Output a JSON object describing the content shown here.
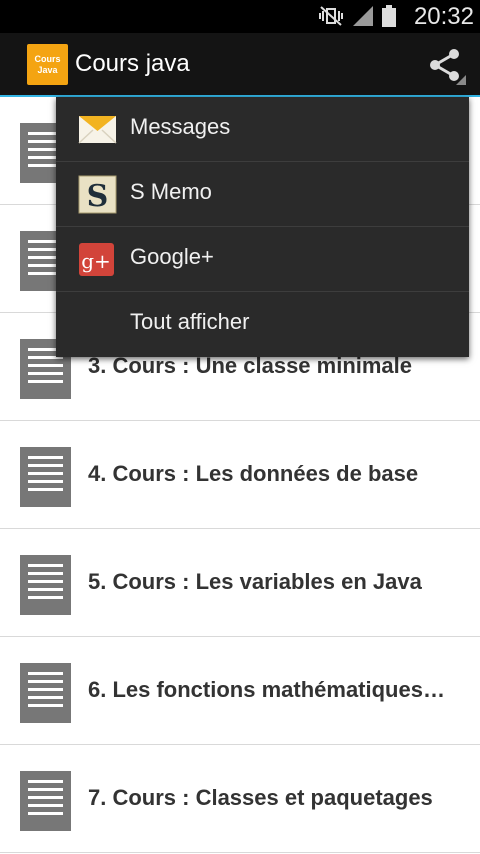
{
  "status_bar": {
    "time": "20:32"
  },
  "action_bar": {
    "app_icon_line1": "Cours",
    "app_icon_line2": "Java",
    "title": "Cours java"
  },
  "list": {
    "items": [
      {
        "label": ""
      },
      {
        "label": ""
      },
      {
        "label": "3.   Cours : Une classe minimale"
      },
      {
        "label": "4.   Cours : Les données de base"
      },
      {
        "label": "5.   Cours : Les variables en Java"
      },
      {
        "label": "6.   Les fonctions mathématiques…"
      },
      {
        "label": "7.   Cours : Classes et paquetages"
      }
    ]
  },
  "share_menu": {
    "items": [
      {
        "label": "Messages",
        "icon": "messages-icon"
      },
      {
        "label": "S Memo",
        "icon": "s-memo-icon"
      },
      {
        "label": "Google+",
        "icon": "google-plus-icon"
      },
      {
        "label": "Tout afficher",
        "icon": ""
      }
    ]
  },
  "colors": {
    "action_bar": "#141414",
    "accent": "#33b5e5",
    "app_icon": "#f4a412",
    "menu_bg": "#2a2a2a"
  }
}
